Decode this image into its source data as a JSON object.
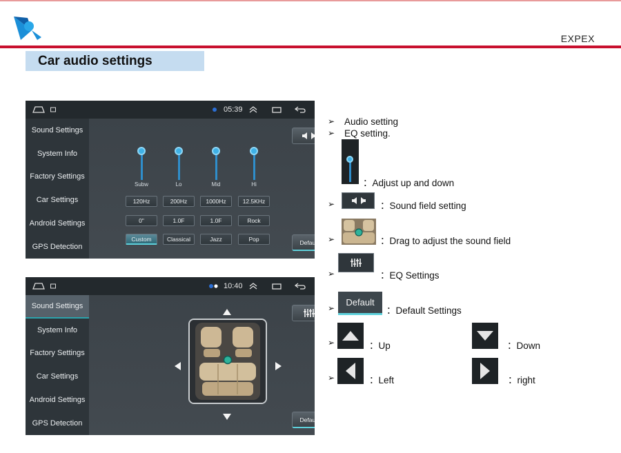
{
  "brand": "EXPEX",
  "section_title": "Car audio settings",
  "screen1": {
    "time": "05:39",
    "sidebar": [
      "Sound Settings",
      "System Info",
      "Factory Settings",
      "Car Settings",
      "Android Settings",
      "GPS Detection"
    ],
    "eq_bands": [
      "Subw",
      "Lo",
      "Mid",
      "Hi"
    ],
    "eq_levels_pct": [
      0.95,
      0.95,
      0.95,
      0.95
    ],
    "freq_row": [
      "120Hz",
      "200Hz",
      "1000Hz",
      "12.5KHz"
    ],
    "value_row": [
      "0\"",
      "1.0F",
      "1.0F",
      "Rock"
    ],
    "preset_row": [
      "Custom",
      "Classical",
      "Jazz",
      "Pop"
    ],
    "selected_preset": "Custom",
    "default_label": "Default"
  },
  "screen2": {
    "time": "10:40",
    "sidebar": [
      "Sound Settings",
      "System Info",
      "Factory Settings",
      "Car Settings",
      "Android Settings",
      "GPS Detection"
    ],
    "active_item": "Sound Settings",
    "default_label": "Default"
  },
  "legend": {
    "audio_setting": "Audio setting",
    "eq_setting": "EQ setting.",
    "adjust": "：Adjust up and down",
    "sound_field": "：Sound field setting",
    "drag": "：Drag to adjust the sound field",
    "eq_settings": "：EQ Settings",
    "default_thumb": "Default",
    "default_settings": "：Default Settings",
    "up": "：Up",
    "down": "：Down",
    "left": "：Left",
    "right": "：right"
  },
  "colors": {
    "accent_red": "#c8102e",
    "title_bg": "#c5dcf0",
    "screen_bg": "#3a4147",
    "teal": "#2ba3ad",
    "slider_blue": "#2f8ecb"
  }
}
